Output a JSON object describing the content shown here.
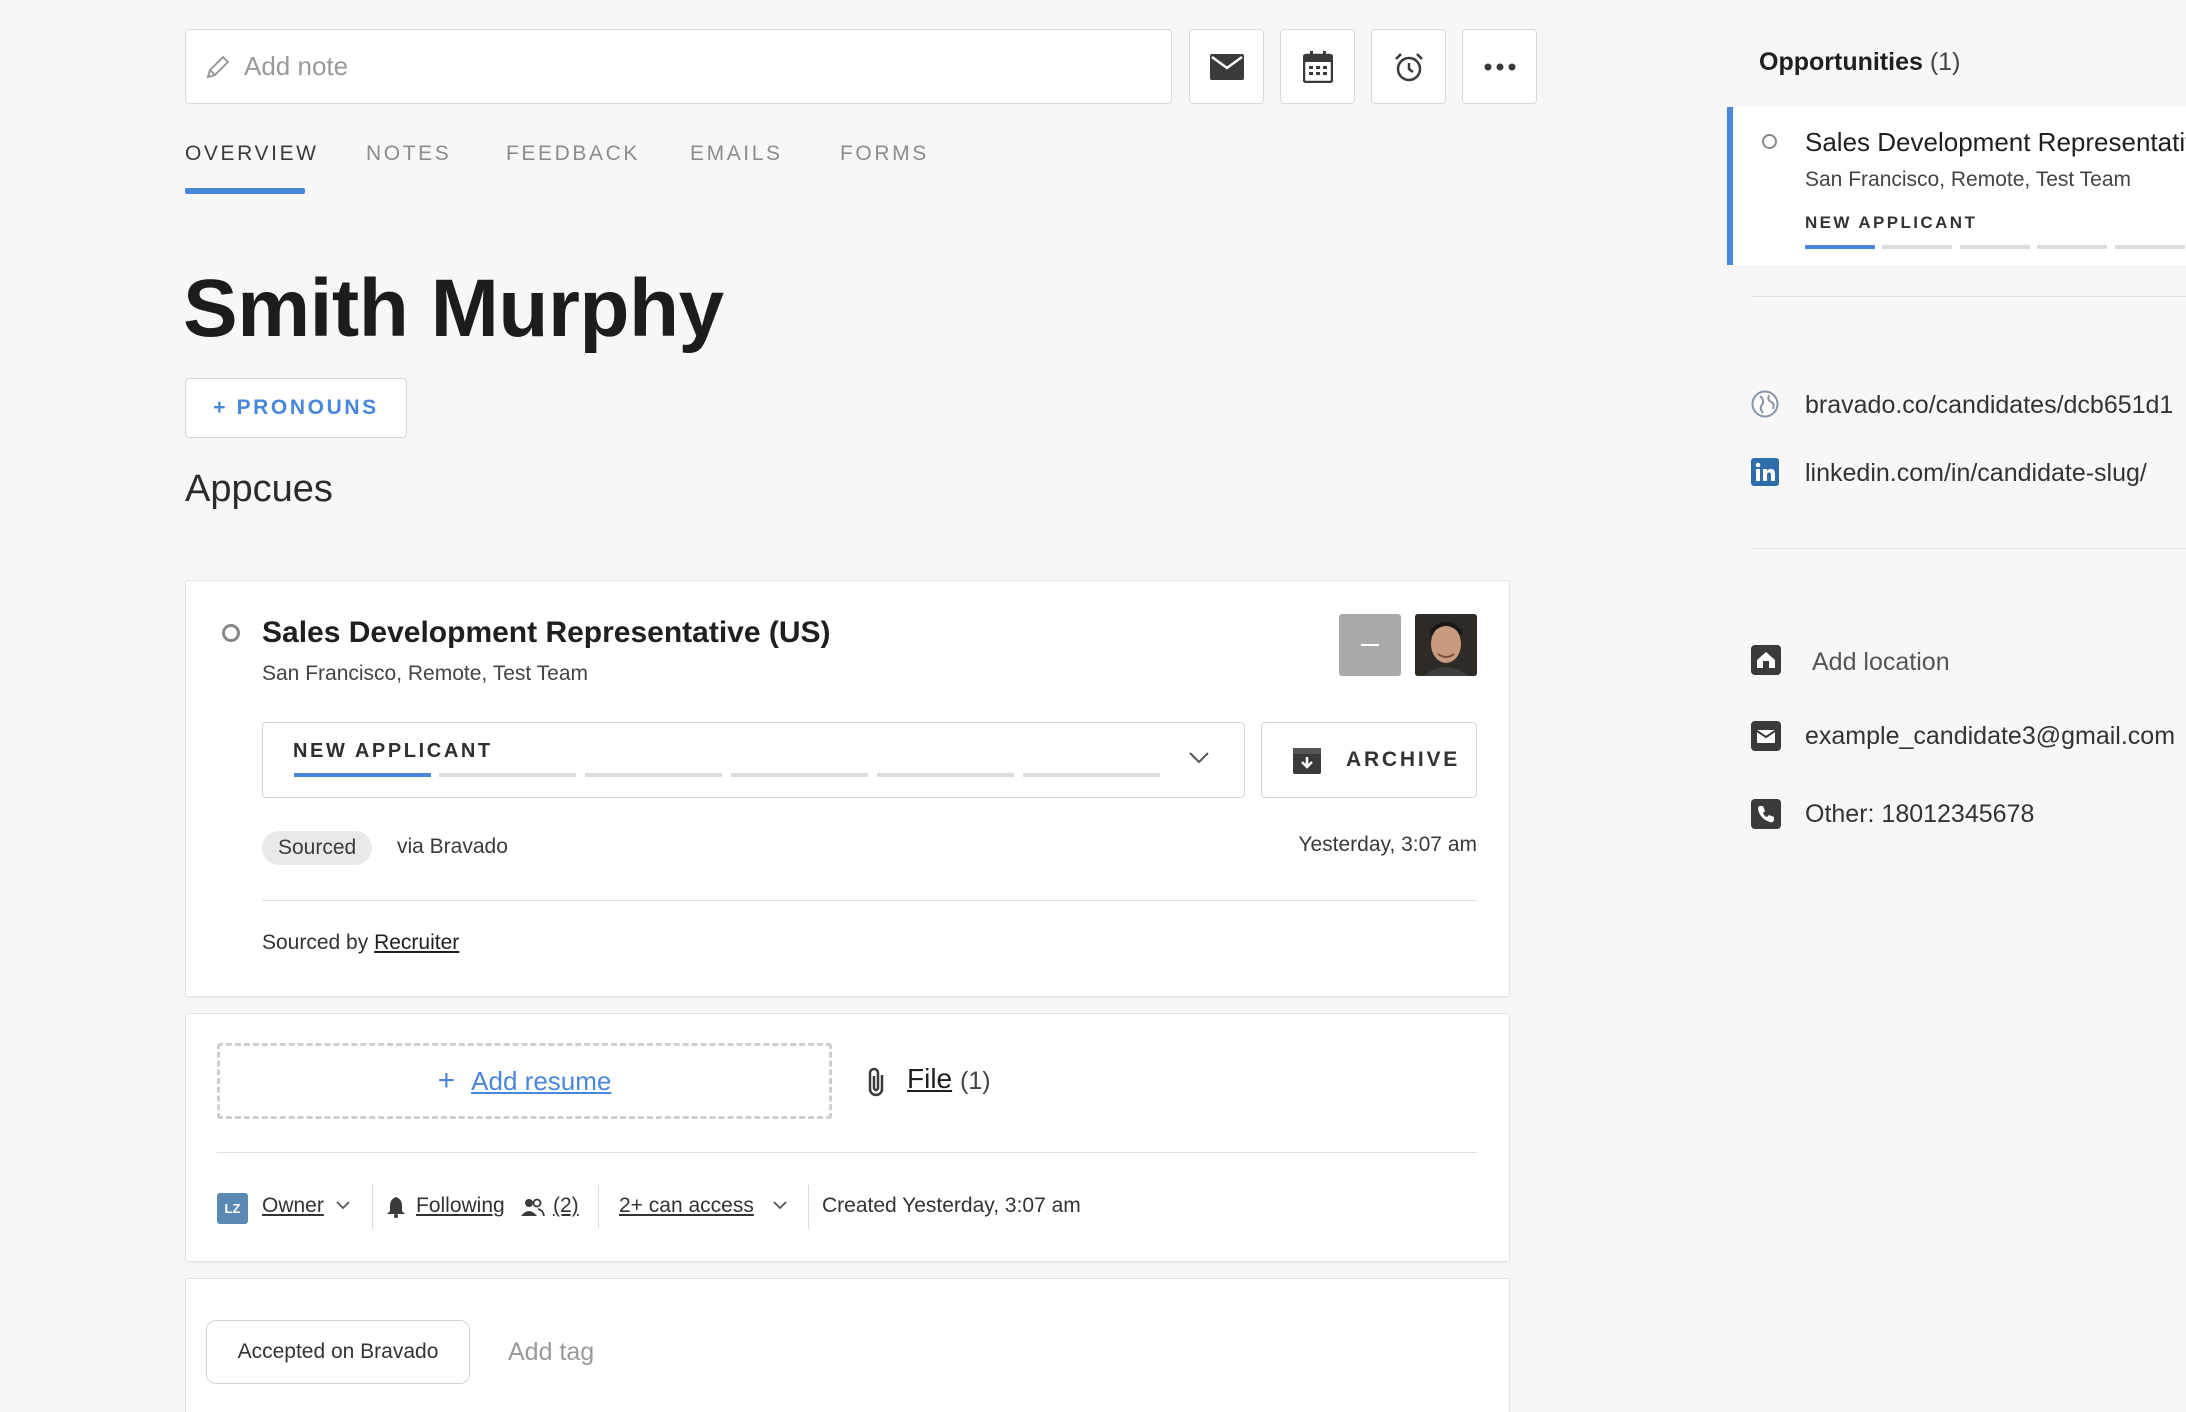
{
  "toolbar": {
    "note_placeholder": "Add note",
    "icons": [
      "mail-icon",
      "calendar-icon",
      "alarm-icon",
      "more-icon"
    ]
  },
  "tabs": [
    {
      "label": "OVERVIEW",
      "active": true
    },
    {
      "label": "NOTES",
      "active": false
    },
    {
      "label": "FEEDBACK",
      "active": false
    },
    {
      "label": "EMAILS",
      "active": false
    },
    {
      "label": "FORMS",
      "active": false
    }
  ],
  "candidate": {
    "name": "Smith Murphy",
    "pronouns_button": "+ PRONOUNS",
    "company": "Appcues"
  },
  "opportunity": {
    "title": "Sales Development Representative (US)",
    "subtitle": "San Francisco, Remote, Test Team",
    "stage": "NEW APPLICANT",
    "stage_progress": "1 of 6",
    "archive_label": "ARCHIVE",
    "source_badge": "Sourced",
    "source_via": "via Bravado",
    "timestamp": "Yesterday, 3:07 am",
    "sourced_by_prefix": "Sourced by",
    "sourced_by_name": "Recruiter"
  },
  "files": {
    "add_resume": "Add resume",
    "file_label": "File",
    "file_count": "(1)"
  },
  "meta": {
    "owner_initials": "LZ",
    "owner_label": "Owner",
    "following_label": "Following",
    "followers_count": "(2)",
    "access_label": "2+ can access",
    "created": "Created Yesterday, 3:07 am"
  },
  "tags": {
    "items": [
      "Accepted on Bravado"
    ],
    "add_placeholder": "Add tag"
  },
  "sidebar": {
    "opportunities_label": "Opportunities",
    "opportunities_count": "(1)",
    "opp_title": "Sales Development Representative (US)",
    "opp_subtitle": "San Francisco, Remote, Test Team",
    "opp_stage": "NEW APPLICANT",
    "links": [
      {
        "icon": "globe-icon",
        "text": "bravado.co/candidates/dcb651d1"
      },
      {
        "icon": "linkedin-icon",
        "text": "linkedin.com/in/candidate-slug/"
      }
    ],
    "location_label": "Add location",
    "email": "example_candidate3@gmail.com",
    "phone": "Other: 18012345678"
  },
  "colors": {
    "accent": "#4a86d9",
    "background": "#f7f7f7"
  }
}
